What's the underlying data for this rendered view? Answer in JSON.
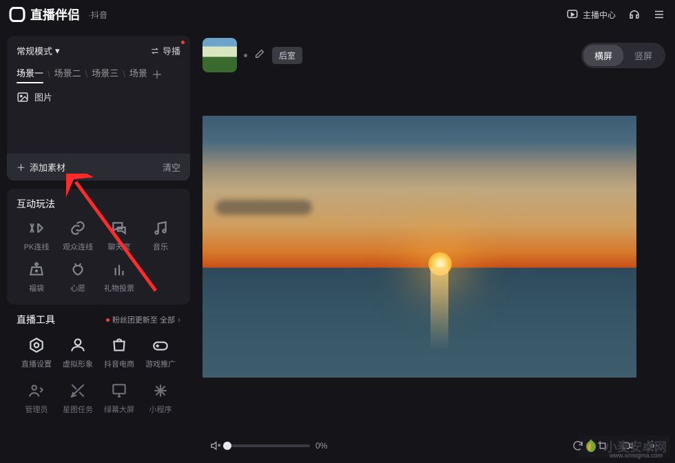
{
  "header": {
    "app_title": "直播伴侣",
    "sub_title": "·抖音",
    "center_label": "主播中心"
  },
  "left": {
    "mode_label": "常规模式",
    "cast_label": "导播",
    "scene_tabs": [
      "场景一",
      "场景二",
      "场景三",
      "场景"
    ],
    "image_item": "图片",
    "add_asset_label": "添加素材",
    "clear_label": "清空",
    "interact": {
      "title": "互动玩法",
      "row1": [
        "PK连线",
        "观众连线",
        "聊天室",
        "音乐"
      ],
      "row2": [
        "福袋",
        "心愿",
        "礼物投票"
      ]
    },
    "tools": {
      "title": "直播工具",
      "update_notice": "粉丝团更新至 全部",
      "row1": [
        "直播设置",
        "虚拟形象",
        "抖音电商",
        "游戏推广"
      ],
      "row2": [
        "管理员",
        "星图任务",
        "绿幕大屏",
        "小程序"
      ]
    }
  },
  "right": {
    "room_tag": "后室",
    "orient_horiz": "横屏",
    "orient_vert": "竖屏",
    "volume_pct": "0%"
  },
  "watermark": {
    "text": "小麦安卓网",
    "url": "www.xmsigma.com"
  }
}
